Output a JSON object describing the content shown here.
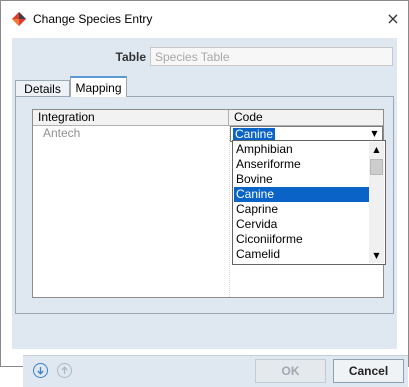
{
  "window": {
    "title": "Change Species Entry",
    "close_glyph": "×",
    "logo_icon": "app-logo-icon",
    "brand_color": "#e03a2e"
  },
  "form": {
    "table_label": "Table",
    "table_value": "Species Table"
  },
  "tabs": [
    {
      "label": "Details",
      "active": false
    },
    {
      "label": "Mapping",
      "active": true
    }
  ],
  "grid": {
    "columns": [
      "Integration",
      "Code"
    ],
    "rows": [
      {
        "integration": "Antech",
        "code": "Canine"
      }
    ]
  },
  "dropdown": {
    "selected": "Canine",
    "options": [
      "Amphibian",
      "Anseriforme",
      "Bovine",
      "Canine",
      "Caprine",
      "Cervida",
      "Ciconiiforme",
      "Camelid"
    ]
  },
  "footer": {
    "ok_label": "OK",
    "cancel_label": "Cancel",
    "ok_enabled": false
  },
  "colors": {
    "panel_bg": "#dfe8f0",
    "selection": "#0a64c8",
    "active_tab_accent": "#5b9bd5"
  }
}
